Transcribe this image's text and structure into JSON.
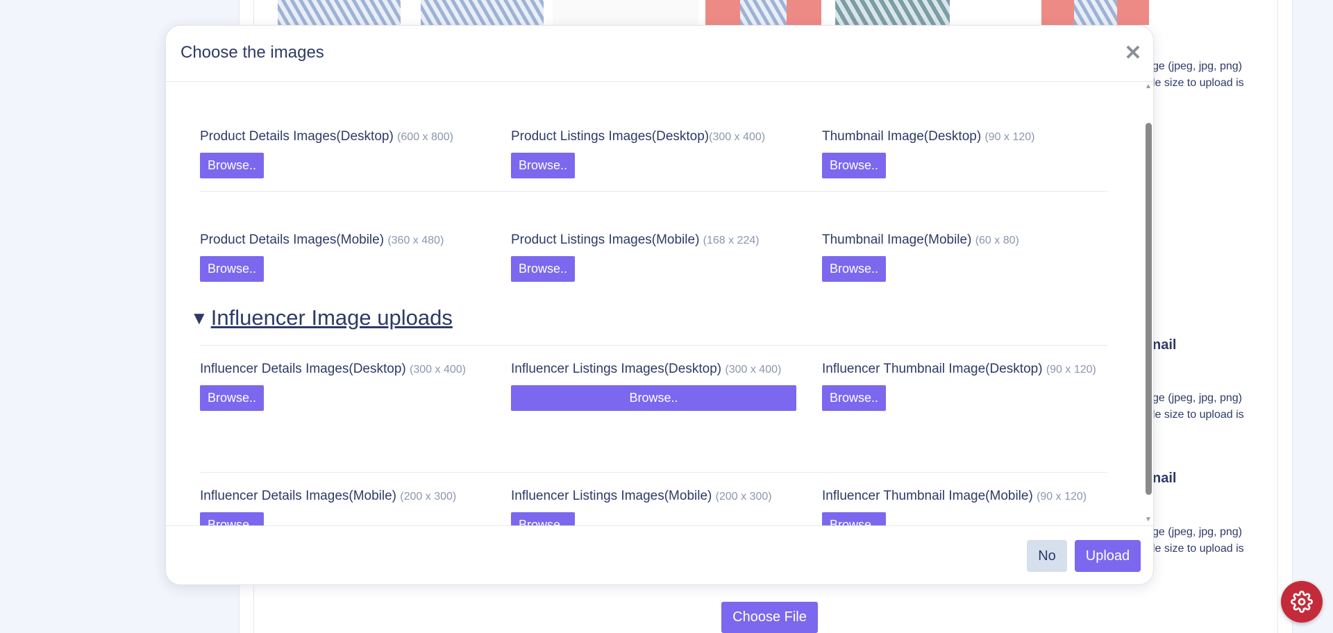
{
  "background": {
    "bold_labels": [
      "nail",
      "nail"
    ],
    "hint_lines": {
      "first": "ge (jpeg, jpg, png)",
      "second": "le size to upload is"
    },
    "choose_file_label": "Choose File",
    "settings_icon": "gear-icon"
  },
  "modal": {
    "title": "Choose the images",
    "close_icon": "close-icon",
    "fields_row1": [
      {
        "label": "Product Details Images(Desktop)",
        "size": "(600 x 800)",
        "button": "Browse.."
      },
      {
        "label": "Product Listings Images(Desktop)",
        "size": "(300 x 400)",
        "button": "Browse.."
      },
      {
        "label": "Thumbnail Image(Desktop)",
        "size": "(90 x 120)",
        "button": "Browse.."
      }
    ],
    "fields_row2": [
      {
        "label": "Product Details Images(Mobile)",
        "size": "(360 x 480)",
        "button": "Browse.."
      },
      {
        "label": "Product Listings Images(Mobile)",
        "size": "(168 x 224)",
        "button": "Browse.."
      },
      {
        "label": "Thumbnail Image(Mobile)",
        "size": "(60 x 80)",
        "button": "Browse.."
      }
    ],
    "section": {
      "toggle_icon": "▼",
      "title": "Influencer Image uploads"
    },
    "fields_row3": [
      {
        "label": "Influencer Details Images(Desktop)",
        "size": "(300 x 400)",
        "button": "Browse.."
      },
      {
        "label": "Influencer Listings Images(Desktop)",
        "size": "(300 x 400)",
        "button": "Browse.."
      },
      {
        "label": "Influencer Thumbnail Image(Desktop)",
        "size": "(90 x 120)",
        "button": "Browse.."
      }
    ],
    "fields_row4": [
      {
        "label": "Influencer Details Images(Mobile)",
        "size": "(200 x 300)",
        "button": "Browse.."
      },
      {
        "label": "Influencer Listings Images(Mobile)",
        "size": "(200 x 300)",
        "button": "Browse.."
      },
      {
        "label": "Influencer Thumbnail Image(Mobile)",
        "size": "(90 x 120)",
        "button": "Browse.."
      }
    ],
    "footer": {
      "no_label": "No",
      "upload_label": "Upload"
    }
  },
  "colors": {
    "accent": "#7b68ee",
    "text": "#2c3a66",
    "muted": "#8b96ad",
    "secondary_button": "#d6dfec",
    "settings_fab": "#c42b3a"
  }
}
